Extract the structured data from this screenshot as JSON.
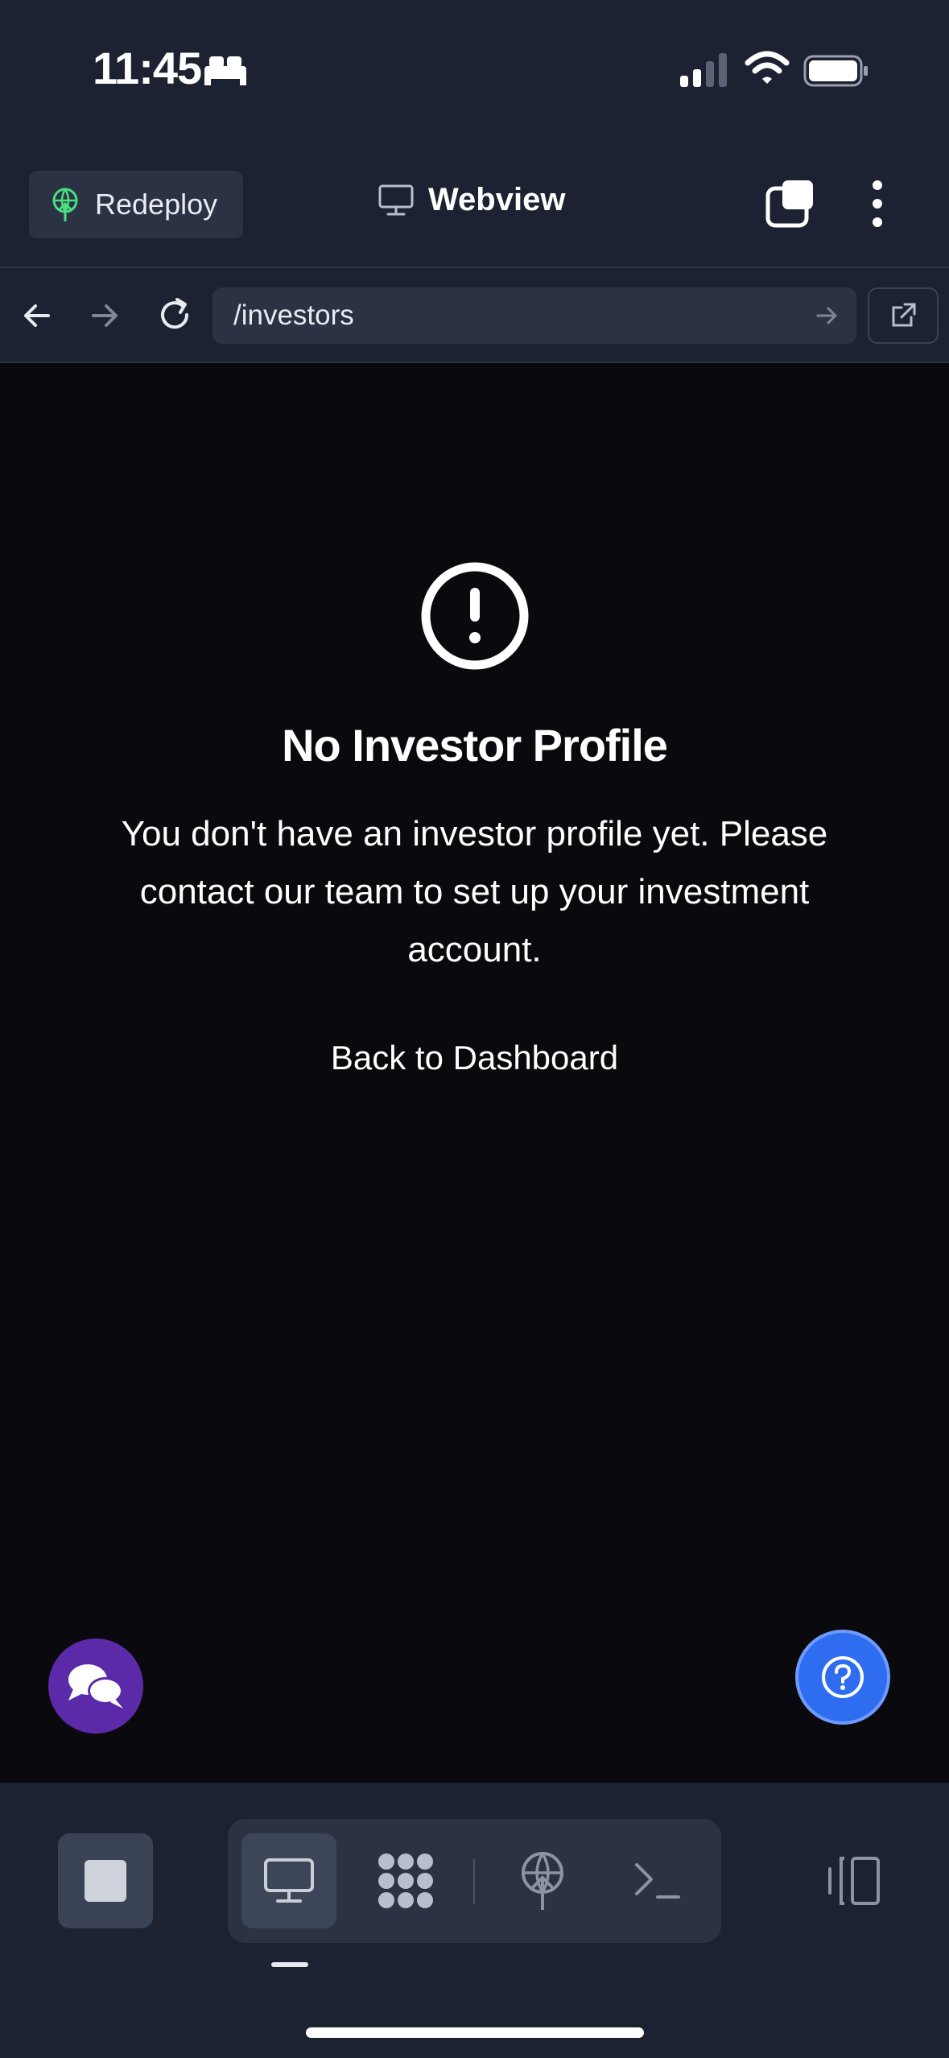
{
  "status_bar": {
    "time": "11:45",
    "focus_icon": "bed-icon",
    "signal_icon": "signal-icon",
    "wifi_icon": "wifi-icon",
    "battery_icon": "battery-icon"
  },
  "header": {
    "redeploy_label": "Redeploy",
    "title": "Webview",
    "title_icon": "monitor-icon",
    "windows_icon": "windows-icon",
    "menu_icon": "kebab-menu-icon"
  },
  "url_bar": {
    "url": "/investors",
    "back_icon": "arrow-left-icon",
    "forward_icon": "arrow-right-icon",
    "reload_icon": "reload-icon",
    "go_icon": "arrow-right-icon",
    "open_external_icon": "external-link-icon"
  },
  "content": {
    "icon": "alert-circle-icon",
    "heading": "No Investor Profile",
    "message": "You don't have an investor profile yet. Please contact our team to set up your investment account.",
    "back_link": "Back to Dashboard"
  },
  "fabs": {
    "chat_icon": "chat-bubbles-icon",
    "help_icon": "help-circle-icon"
  },
  "bottom_bar": {
    "tabs": [
      {
        "name": "stop",
        "icon": "stop-icon"
      },
      {
        "name": "webview",
        "icon": "monitor-icon",
        "active": true
      },
      {
        "name": "packages",
        "icon": "packages-icon"
      },
      {
        "name": "deploy",
        "icon": "deploy-icon"
      },
      {
        "name": "shell",
        "icon": "terminal-icon"
      },
      {
        "name": "layout",
        "icon": "layout-icon"
      }
    ]
  },
  "colors": {
    "chrome_bg": "#1c2232",
    "page_bg": "#0a0a0e",
    "chat_fab": "#5b2aa8",
    "help_fab": "#2f6df0",
    "redeploy_accent": "#4ade80"
  }
}
